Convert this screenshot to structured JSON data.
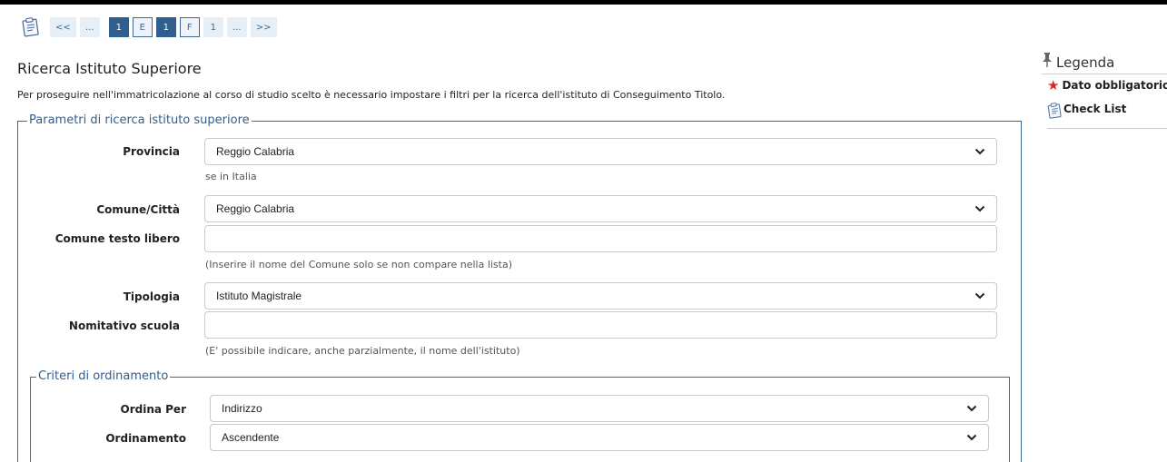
{
  "pagination": {
    "items": [
      "<<",
      "...",
      "1",
      "E",
      "1",
      "F",
      "1",
      "...",
      ">>"
    ]
  },
  "page": {
    "title": "Ricerca Istituto Superiore",
    "intro": "Per proseguire nell'immatricolazione al corso di studio scelto è necessario impostare i filtri per la ricerca dell'istituto di Conseguimento Titolo."
  },
  "search_params": {
    "legend": "Parametri di ricerca istituto superiore",
    "provincia": {
      "label": "Provincia",
      "value": "Reggio Calabria",
      "hint": "se in Italia"
    },
    "comune": {
      "label": "Comune/Città",
      "value": "Reggio Calabria"
    },
    "comune_libero": {
      "label": "Comune testo libero",
      "value": "",
      "hint": "(Inserire il nome del Comune solo se non compare nella lista)"
    },
    "tipologia": {
      "label": "Tipologia",
      "value": "Istituto Magistrale"
    },
    "nominativo": {
      "label": "Nomitativo scuola",
      "value": "",
      "hint": "(E' possibile indicare, anche parzialmente, il nome dell'istituto)"
    }
  },
  "sort": {
    "legend": "Criteri di ordinamento",
    "ordina_per": {
      "label": "Ordina Per",
      "value": "Indirizzo"
    },
    "ordinamento": {
      "label": "Ordinamento",
      "value": "Ascendente"
    }
  },
  "legend_panel": {
    "title": "Legenda",
    "required": "Dato obbligatorio",
    "checklist": "Check List"
  },
  "colors": {
    "accent": "#2f5f8f",
    "required_star": "#d6262b"
  },
  "icons": [
    "clipboard-icon",
    "pin-icon",
    "asterisk-icon",
    "chevron-down-icon"
  ]
}
